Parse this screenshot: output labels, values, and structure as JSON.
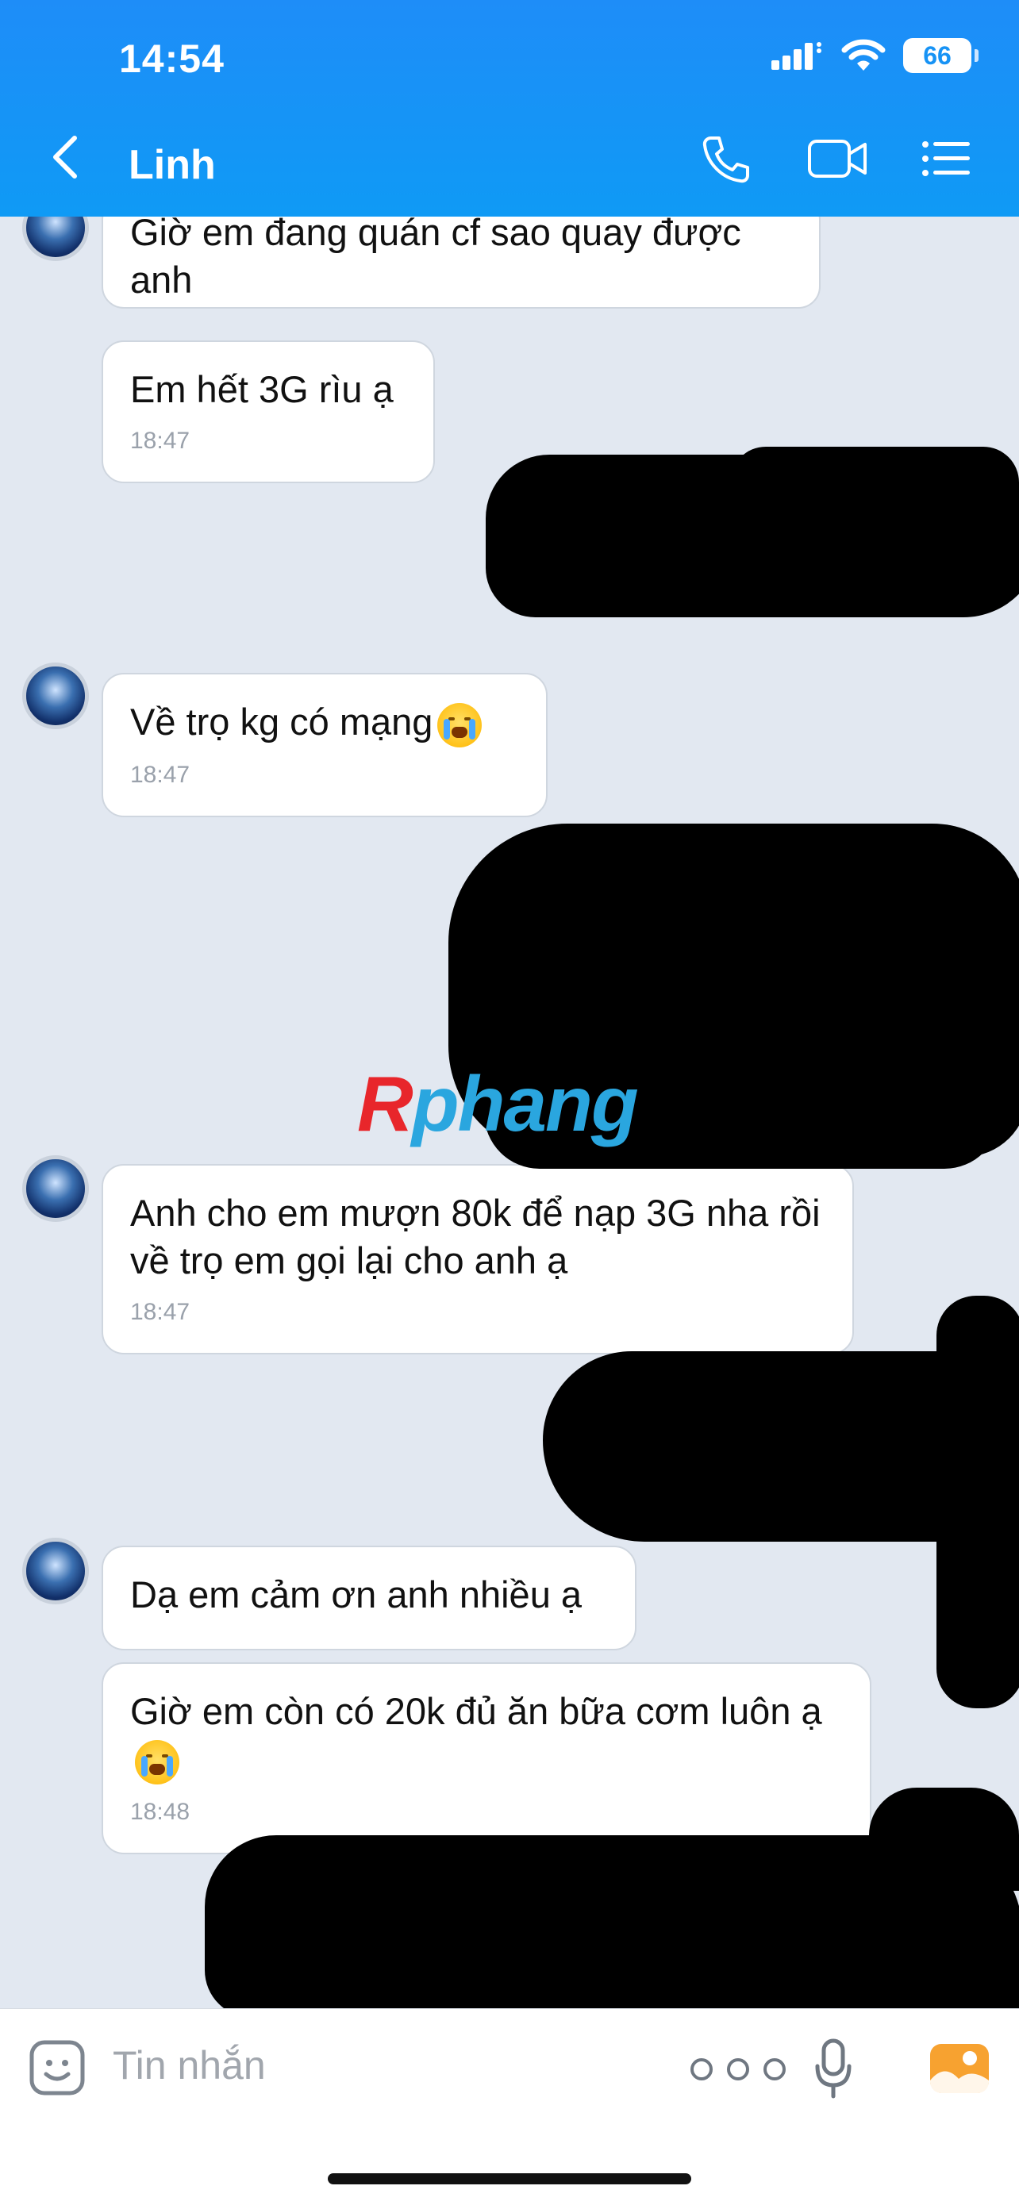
{
  "status_bar": {
    "time": "14:54",
    "battery": "66"
  },
  "header": {
    "contact_name": "Linh"
  },
  "messages": [
    {
      "text": "Giờ em đang quán cf sao quay được anh",
      "time": ""
    },
    {
      "text": "Em hết 3G rìu ạ",
      "time": "18:47"
    },
    {
      "text": "Về trọ kg có mạng",
      "time": "18:47",
      "emoji": "crying-emoji"
    },
    {
      "text": "Anh cho em mượn 80k để nạp 3G nha rồi về trọ em gọi lại cho anh ạ",
      "time": "18:47"
    },
    {
      "text": "Dạ em cảm ơn anh nhiều ạ",
      "time": ""
    },
    {
      "text": "Giờ em còn có 20k đủ ăn bữa cơm luôn ạ",
      "time": "18:48",
      "emoji": "crying-emoji"
    }
  ],
  "watermark": {
    "first": "R",
    "rest": "phang"
  },
  "composer": {
    "placeholder": "Tin nhắn"
  }
}
